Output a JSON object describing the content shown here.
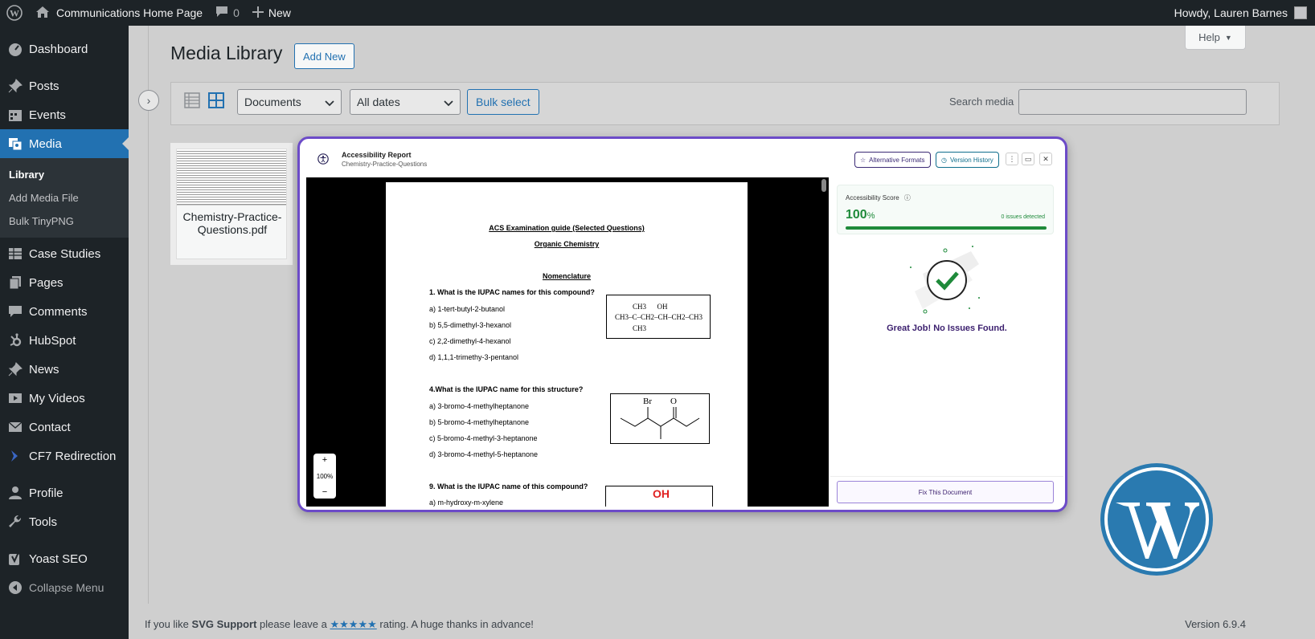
{
  "adminbar": {
    "wp_logo": "wordpress-icon",
    "site_name": "Communications Home Page",
    "comments_count": "0",
    "new_label": "New",
    "howdy": "Howdy, Lauren Barnes"
  },
  "sidebar": {
    "dashboard": "Dashboard",
    "posts": "Posts",
    "events": "Events",
    "media": "Media",
    "media_sub": [
      "Library",
      "Add Media File",
      "Bulk TinyPNG"
    ],
    "case_studies": "Case Studies",
    "pages": "Pages",
    "comments": "Comments",
    "hubspot": "HubSpot",
    "news": "News",
    "my_videos": "My Videos",
    "contact": "Contact",
    "cf7": "CF7 Redirection",
    "profile": "Profile",
    "tools": "Tools",
    "yoast": "Yoast SEO",
    "collapse": "Collapse Menu"
  },
  "main": {
    "help": "Help",
    "title": "Media Library",
    "add_new": "Add New",
    "filter_type": "Documents",
    "filter_date": "All dates",
    "bulk_select": "Bulk select",
    "search_label": "Search media",
    "search_value": "",
    "attachment_name": "Chemistry-Practice-Questions.pdf"
  },
  "modal": {
    "title": "Accessibility Report",
    "subtitle": "Chemistry-Practice-Questions",
    "alt_formats": "Alternative Formats",
    "version_history": "Version History",
    "score_label": "Accessibility Score",
    "score_value": "100",
    "score_unit": "%",
    "score_fraction": 1.0,
    "issues": "0 issues detected",
    "great_job": "Great Job! No Issues Found.",
    "fix_button": "Fix This Document",
    "zoom": "100%"
  },
  "document": {
    "title": "ACS Examination guide (Selected Questions)",
    "subtitle": "Organic Chemistry",
    "section": "Nomenclature",
    "q1": "1. What is the IUPAC names for this compound?",
    "q1_opts": [
      "a) 1-tert-butyl-2-butanol",
      "b) 5,5-dimethyl-3-hexanol",
      "c) 2,2-dimethyl-4-hexanol",
      "d) 1,1,1-trimethy-3-pentanol"
    ],
    "q1_opt_prefix_b": "b)",
    "q4": "4.What is the IUPAC name for this structure?",
    "q4_opts": [
      " a) 3-bromo-4-methylheptanone",
      "b) 5-bromo-4-methylheptanone",
      "c) 5-bromo-4-methyl-3-heptanone",
      "d) 3-bromo-4-methyl-5-heptanone"
    ],
    "q9": "9. What is the IUPAC name of this compound?",
    "q9_partial": "a) m-hydroxy-m-xylene",
    "struct1_top": "CH3      OH",
    "struct1_mid": "CH3–C–CH2–CH–CH2–CH3",
    "struct1_bot": "CH3",
    "struct2_labels": [
      "Br",
      "O"
    ],
    "struct3_label": "OH"
  },
  "footer": {
    "left_prefix": "If you like ",
    "left_plugin": "SVG Support",
    "left_mid": " please leave a ",
    "left_stars": "★★★★★",
    "left_suffix": " rating. A huge thanks in advance!",
    "version": "Version 6.9.4"
  },
  "colors": {
    "admin_dark": "#1d2327",
    "accent": "#2271b1",
    "modal_border": "#6c4bc8",
    "success": "#1e8a3a"
  }
}
